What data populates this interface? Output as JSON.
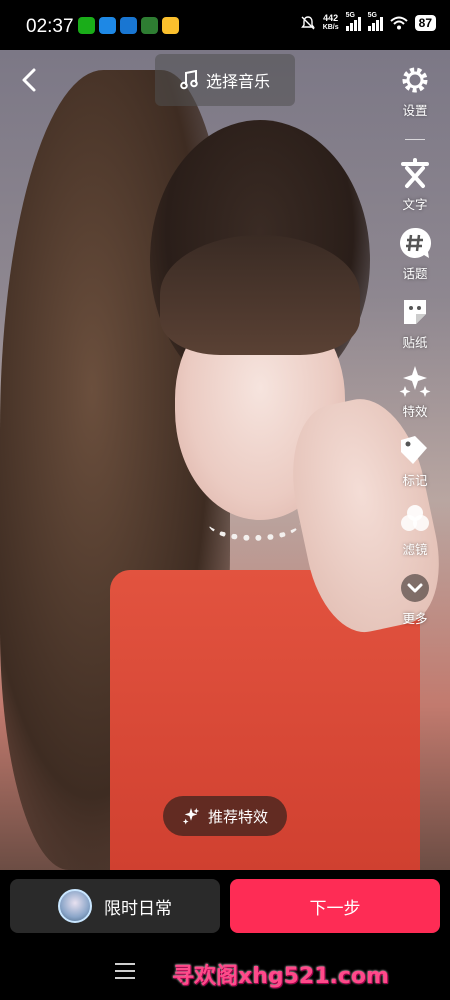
{
  "status_bar": {
    "time": "02:37",
    "net_speed_value": "442",
    "net_speed_unit": "KB/s",
    "signal1_tag": "5G",
    "signal2_tag": "5G",
    "battery": "87",
    "app_icon_colors": [
      "#1aad19",
      "#1e88e5",
      "#1976d2",
      "#2e7d32",
      "#fbc02d"
    ]
  },
  "top": {
    "back_icon": "chevron-left-icon",
    "music_label": "选择音乐",
    "music_icon": "music-note-icon"
  },
  "tools": [
    {
      "id": "settings",
      "label": "设置",
      "icon": "gear-icon"
    },
    {
      "id": "text",
      "label": "文字",
      "icon": "text-icon"
    },
    {
      "id": "topic",
      "label": "话题",
      "icon": "hashtag-icon"
    },
    {
      "id": "sticker",
      "label": "贴纸",
      "icon": "sticker-icon"
    },
    {
      "id": "effects",
      "label": "特效",
      "icon": "sparkle-icon"
    },
    {
      "id": "mark",
      "label": "标记",
      "icon": "tag-icon"
    },
    {
      "id": "filter",
      "label": "滤镜",
      "icon": "filter-icon"
    },
    {
      "id": "more",
      "label": "更多",
      "icon": "chevron-down-icon"
    }
  ],
  "recommend_effects": {
    "label": "推荐特效",
    "icon": "sparkle-icon"
  },
  "bottom": {
    "moment_label": "限时日常",
    "next_label": "下一步",
    "menu_icon": "menu-icon"
  },
  "watermark": "寻欢阁xhg521.com",
  "colors": {
    "accent": "#fe2c55",
    "moment_bg": "#2a2a2a"
  }
}
